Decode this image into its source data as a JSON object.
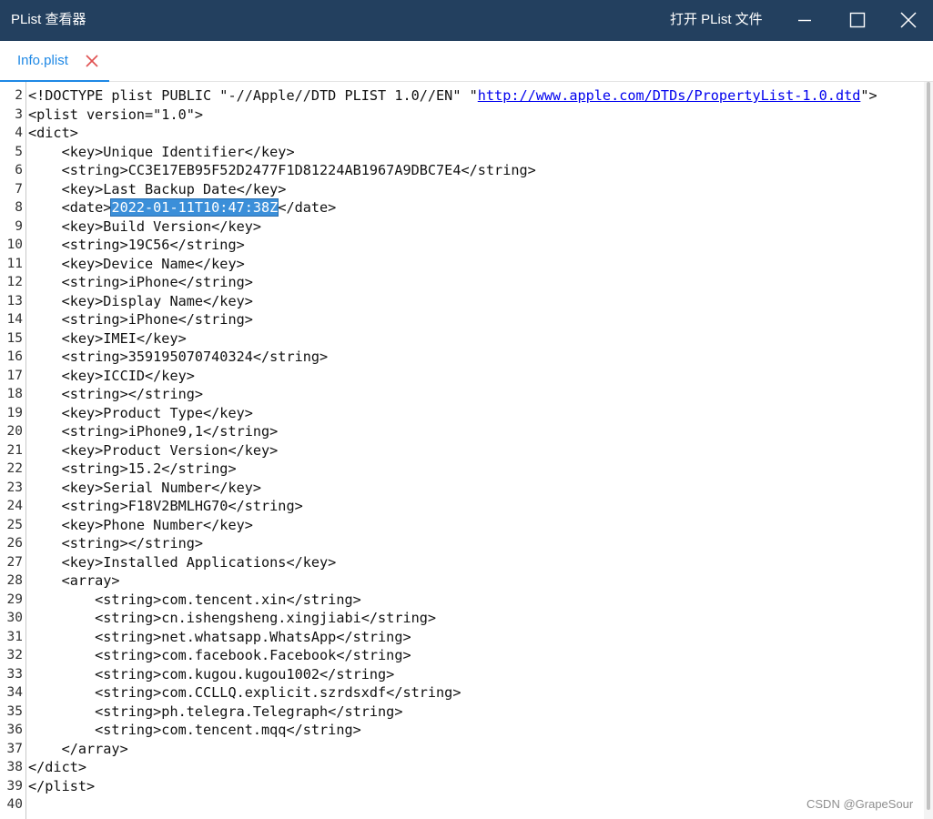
{
  "window": {
    "title": "PList 查看器",
    "open_button": "打开 PList 文件",
    "colors": {
      "titlebar": "#23405f",
      "accent": "#1e88e5",
      "selection": "#3b8fd9"
    }
  },
  "tabs": [
    {
      "label": "Info.plist",
      "close_icon": "close-icon"
    }
  ],
  "editor": {
    "lines": [
      {
        "num": "2",
        "parts": [
          {
            "t": "<!DOCTYPE plist PUBLIC \"-//Apple//DTD PLIST 1.0//EN\" \""
          },
          {
            "t": "http://www.apple.com/DTDs/PropertyList-1.0.dtd",
            "kind": "url"
          },
          {
            "t": "\">"
          }
        ]
      },
      {
        "num": "3",
        "parts": [
          {
            "t": "<plist version=\"1.0\">"
          }
        ]
      },
      {
        "num": "4",
        "parts": [
          {
            "t": "<dict>"
          }
        ]
      },
      {
        "num": "5",
        "parts": [
          {
            "t": "    <key>Unique Identifier</key>"
          }
        ]
      },
      {
        "num": "6",
        "parts": [
          {
            "t": "    <string>CC3E17EB95F52D2477F1D81224AB1967A9DBC7E4</string>"
          }
        ]
      },
      {
        "num": "7",
        "parts": [
          {
            "t": "    <key>Last Backup Date</key>"
          }
        ]
      },
      {
        "num": "8",
        "parts": [
          {
            "t": "    <date>"
          },
          {
            "t": "2022-01-11T10:47:38Z",
            "kind": "sel"
          },
          {
            "t": "</date>"
          }
        ]
      },
      {
        "num": "9",
        "parts": [
          {
            "t": "    <key>Build Version</key>"
          }
        ]
      },
      {
        "num": "10",
        "parts": [
          {
            "t": "    <string>19C56</string>"
          }
        ]
      },
      {
        "num": "11",
        "parts": [
          {
            "t": "    <key>Device Name</key>"
          }
        ]
      },
      {
        "num": "12",
        "parts": [
          {
            "t": "    <string>iPhone</string>"
          }
        ]
      },
      {
        "num": "13",
        "parts": [
          {
            "t": "    <key>Display Name</key>"
          }
        ]
      },
      {
        "num": "14",
        "parts": [
          {
            "t": "    <string>iPhone</string>"
          }
        ]
      },
      {
        "num": "15",
        "parts": [
          {
            "t": "    <key>IMEI</key>"
          }
        ]
      },
      {
        "num": "16",
        "parts": [
          {
            "t": "    <string>359195070740324</string>"
          }
        ]
      },
      {
        "num": "17",
        "parts": [
          {
            "t": "    <key>ICCID</key>"
          }
        ]
      },
      {
        "num": "18",
        "parts": [
          {
            "t": "    <string></string>"
          }
        ]
      },
      {
        "num": "19",
        "parts": [
          {
            "t": "    <key>Product Type</key>"
          }
        ]
      },
      {
        "num": "20",
        "parts": [
          {
            "t": "    <string>iPhone9,1</string>"
          }
        ]
      },
      {
        "num": "21",
        "parts": [
          {
            "t": "    <key>Product Version</key>"
          }
        ]
      },
      {
        "num": "22",
        "parts": [
          {
            "t": "    <string>15.2</string>"
          }
        ]
      },
      {
        "num": "23",
        "parts": [
          {
            "t": "    <key>Serial Number</key>"
          }
        ]
      },
      {
        "num": "24",
        "parts": [
          {
            "t": "    <string>F18V2BMLHG70</string>"
          }
        ]
      },
      {
        "num": "25",
        "parts": [
          {
            "t": "    <key>Phone Number</key>"
          }
        ]
      },
      {
        "num": "26",
        "parts": [
          {
            "t": "    <string></string>"
          }
        ]
      },
      {
        "num": "27",
        "parts": [
          {
            "t": "    <key>Installed Applications</key>"
          }
        ]
      },
      {
        "num": "28",
        "parts": [
          {
            "t": "    <array>"
          }
        ]
      },
      {
        "num": "29",
        "parts": [
          {
            "t": "        <string>com.tencent.xin</string>"
          }
        ]
      },
      {
        "num": "30",
        "parts": [
          {
            "t": "        <string>cn.ishengsheng.xingjiabi</string>"
          }
        ]
      },
      {
        "num": "31",
        "parts": [
          {
            "t": "        <string>net.whatsapp.WhatsApp</string>"
          }
        ]
      },
      {
        "num": "32",
        "parts": [
          {
            "t": "        <string>com.facebook.Facebook</string>"
          }
        ]
      },
      {
        "num": "33",
        "parts": [
          {
            "t": "        <string>com.kugou.kugou1002</string>"
          }
        ]
      },
      {
        "num": "34",
        "parts": [
          {
            "t": "        <string>com.CCLLQ.explicit.szrdsxdf</string>"
          }
        ]
      },
      {
        "num": "35",
        "parts": [
          {
            "t": "        <string>ph.telegra.Telegraph</string>"
          }
        ]
      },
      {
        "num": "36",
        "parts": [
          {
            "t": "        <string>com.tencent.mqq</string>"
          }
        ]
      },
      {
        "num": "37",
        "parts": [
          {
            "t": "    </array>"
          }
        ]
      },
      {
        "num": "38",
        "parts": [
          {
            "t": "</dict>"
          }
        ]
      },
      {
        "num": "39",
        "parts": [
          {
            "t": "</plist>"
          }
        ]
      },
      {
        "num": "40",
        "parts": [
          {
            "t": ""
          }
        ]
      }
    ]
  },
  "watermark": "CSDN @GrapeSour"
}
